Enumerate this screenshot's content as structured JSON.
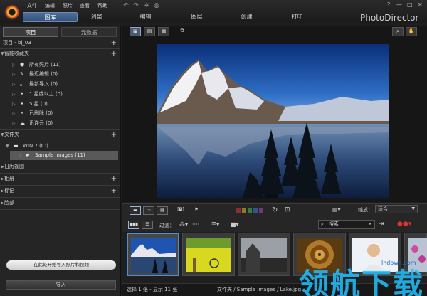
{
  "app": {
    "brand": "PhotoDirector"
  },
  "menu": [
    "文件",
    "编辑",
    "照片",
    "查看",
    "帮助"
  ],
  "module_tabs": [
    "图库",
    "调整",
    "编辑",
    "图层",
    "创建",
    "打印"
  ],
  "window_controls": {
    "help": "?",
    "minimize": "—",
    "maximize": "□",
    "close": "✕"
  },
  "left_panel": {
    "tabs": [
      "项目",
      "元数据"
    ],
    "project": "项目 - bj_03",
    "smart_collections": {
      "label": "智能收藏夹",
      "items": [
        {
          "label": "所有照片 (11)",
          "icon": "photos-icon"
        },
        {
          "label": "最近编辑 (0)",
          "icon": "edit-icon"
        },
        {
          "label": "最新导入 (0)",
          "icon": "import-icon"
        },
        {
          "label": "1 星或以上 (0)",
          "icon": "star-icon"
        },
        {
          "label": "5 星 (0)",
          "icon": "star-icon"
        },
        {
          "label": "已删除 (0)",
          "icon": "trash-icon"
        },
        {
          "label": "讯连云 (0)",
          "icon": "cloud-icon"
        }
      ]
    },
    "folders": {
      "label": "文件夹",
      "drive": "WIN 7 (C:)",
      "selected_folder": "Sample Images (11)"
    },
    "sections": [
      "日历视图",
      "相册",
      "标记",
      "脸部"
    ],
    "import_hint": "在此处开始导入照片和视频",
    "import_button": "导入"
  },
  "toolbar": {
    "filter_label": "过滤：",
    "zoom_label": "缩放：",
    "zoom_value": "适合",
    "search_placeholder": "搜索"
  },
  "status": {
    "selection": "选择 1 张 - 显示 11 张",
    "path": "文件夹 / Sample Images / Lake.jpg"
  },
  "watermark": {
    "text": "领航下载",
    "site": "lhdown.com"
  }
}
